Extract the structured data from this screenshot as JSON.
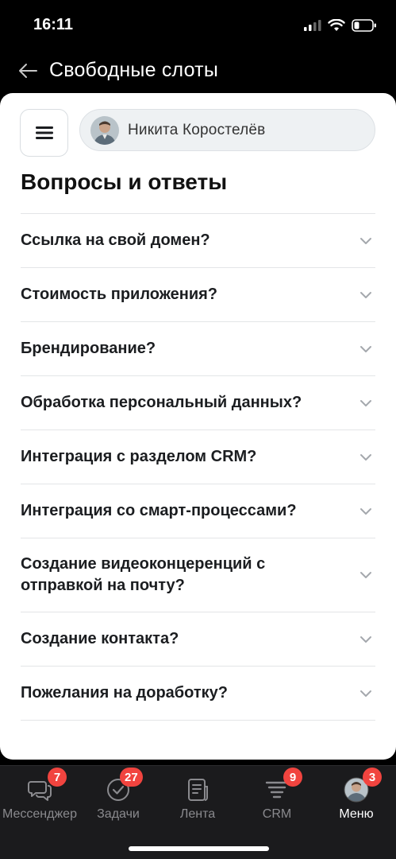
{
  "status_bar": {
    "time": "16:11"
  },
  "header": {
    "title": "Свободные слоты"
  },
  "user": {
    "name": "Никита Коростелёв"
  },
  "page": {
    "title": "Вопросы и ответы"
  },
  "faq": [
    {
      "question": "Ссылка на свой домен?"
    },
    {
      "question": "Стоимость приложения?"
    },
    {
      "question": "Брендирование?"
    },
    {
      "question": "Обработка персональный данных?"
    },
    {
      "question": "Интеграция с разделом CRM?"
    },
    {
      "question": "Интеграция со смарт-процессами?"
    },
    {
      "question": "Создание видеоконцеренций с отправкой на почту?"
    },
    {
      "question": "Создание контакта?"
    },
    {
      "question": "Пожелания на доработку?"
    }
  ],
  "tabs": [
    {
      "label": "Мессенджер",
      "badge": "7",
      "icon": "chat-icon"
    },
    {
      "label": "Задачи",
      "badge": "27",
      "icon": "check-circle-icon"
    },
    {
      "label": "Лента",
      "badge": "",
      "icon": "feed-icon"
    },
    {
      "label": "CRM",
      "badge": "9",
      "icon": "funnel-icon"
    },
    {
      "label": "Меню",
      "badge": "3",
      "icon": "avatar",
      "active": true
    }
  ],
  "colors": {
    "badge": "#f1443f",
    "tab_active": "#ffffff",
    "tab_inactive": "#8a8a8e"
  }
}
